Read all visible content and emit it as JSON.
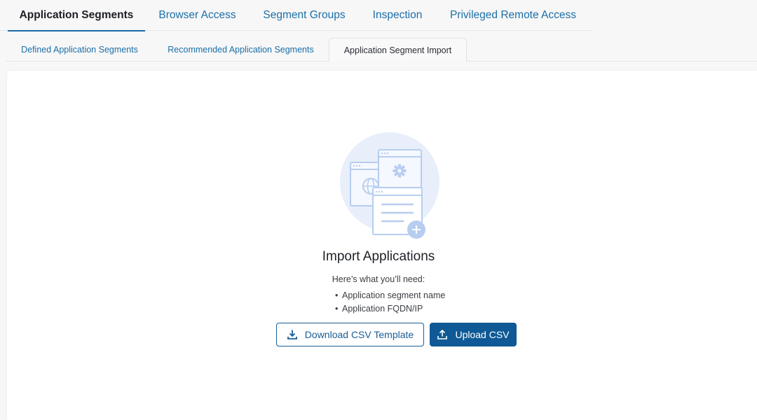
{
  "top_tabs": [
    {
      "label": "Application Segments",
      "active": true
    },
    {
      "label": "Browser Access"
    },
    {
      "label": "Segment Groups"
    },
    {
      "label": "Inspection"
    },
    {
      "label": "Privileged Remote Access"
    }
  ],
  "sub_tabs": [
    {
      "label": "Defined Application Segments"
    },
    {
      "label": "Recommended Application Segments"
    },
    {
      "label": "Application Segment Import",
      "active": true
    }
  ],
  "empty_state": {
    "illustration_icon": "import-applications-illustration",
    "title": "Import Applications",
    "need_label": "Here’s what you’ll need:",
    "requirements": [
      "Application segment name",
      "Application FQDN/IP"
    ]
  },
  "buttons": {
    "download_label": "Download CSV Template",
    "download_icon": "download-icon",
    "upload_label": "Upload CSV",
    "upload_icon": "upload-icon"
  },
  "colors": {
    "accent": "#1a6aa6",
    "primary_button": "#0f5a96",
    "illustration_circle": "#e8effa",
    "illustration_stroke": "#b7cdf0"
  }
}
